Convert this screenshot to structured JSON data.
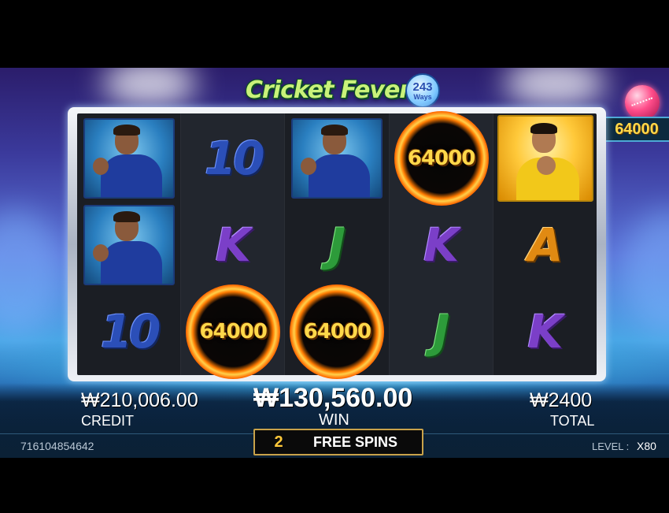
{
  "game": {
    "title": "Cricket Fever",
    "ways": "243",
    "ways_label": "Ways"
  },
  "jackpot": {
    "value": "64000"
  },
  "reels": [
    [
      {
        "type": "card",
        "variant": "blue"
      },
      {
        "type": "card",
        "variant": "blue"
      },
      {
        "type": "letter",
        "text": "10"
      }
    ],
    [
      {
        "type": "letter",
        "text": "10"
      },
      {
        "type": "letter",
        "text": "K"
      },
      {
        "type": "ring",
        "value": "64000"
      }
    ],
    [
      {
        "type": "card",
        "variant": "blue"
      },
      {
        "type": "letter",
        "text": "J"
      },
      {
        "type": "ring",
        "value": "64000"
      }
    ],
    [
      {
        "type": "ring",
        "value": "64000"
      },
      {
        "type": "letter",
        "text": "K"
      },
      {
        "type": "letter",
        "text": "J"
      }
    ],
    [
      {
        "type": "card",
        "variant": "gold"
      },
      {
        "type": "letter",
        "text": "A"
      },
      {
        "type": "letter",
        "text": "K"
      }
    ]
  ],
  "info": {
    "credit_value": "₩210,006.00",
    "credit_label": "CREDIT",
    "win_value": "₩130,560.00",
    "win_label": "WIN",
    "total_value": "₩2400",
    "total_label": "TOTAL",
    "free_spins_count": "2",
    "free_spins_label": "FREE SPINS",
    "round_id": "716104854642",
    "level_label": "LEVEL :",
    "level_value": "X80"
  },
  "colors": {
    "ring_text": "#ffd84a",
    "frame": "#aab3c3",
    "spins_border": "#c9a24a"
  }
}
